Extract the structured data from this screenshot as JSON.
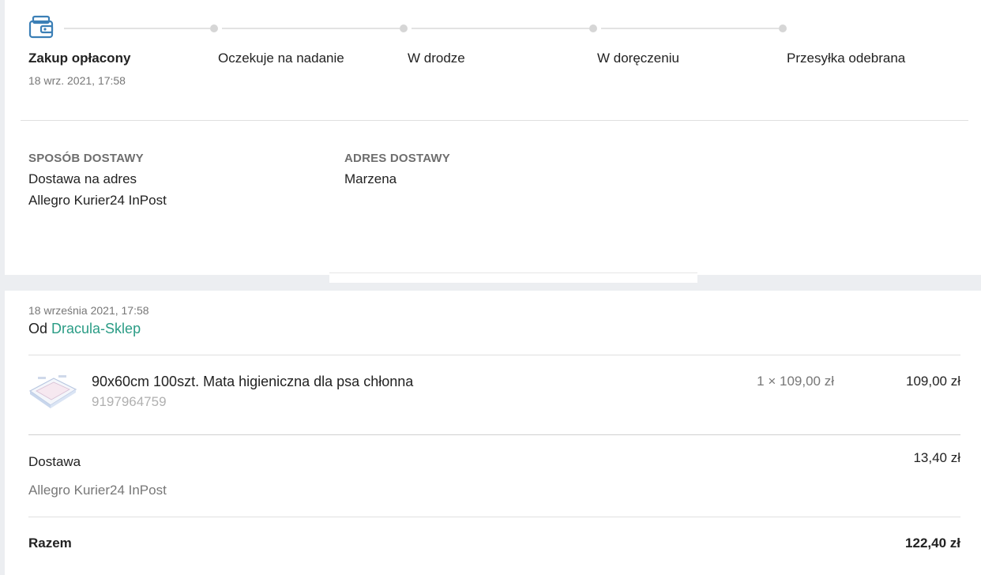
{
  "tracker": {
    "steps": [
      {
        "label": "Zakup opłacony",
        "active": true
      },
      {
        "label": "Oczekuje na nadanie",
        "active": false
      },
      {
        "label": "W drodze",
        "active": false
      },
      {
        "label": "W doręczeniu",
        "active": false
      },
      {
        "label": "Przesyłka odebrana",
        "active": false
      }
    ],
    "active_date": "18 wrz. 2021, 17:58",
    "icon": "wallet-icon",
    "accent_color": "#3b7fb6"
  },
  "delivery": {
    "method_heading": "SPOSÓB DOSTAWY",
    "method_line1": "Dostawa na adres",
    "method_line2": "Allegro Kurier24 InPost",
    "address_heading": "ADRES DOSTAWY",
    "address_name": "Marzena"
  },
  "order": {
    "date": "18 września 2021, 17:58",
    "from_prefix": "Od",
    "seller": "Dracula-Sklep",
    "item": {
      "title": "90x60cm 100szt. Mata higieniczna dla psa chłonna",
      "offer_id": "9197964759",
      "qty_price": "1 × 109,00 zł",
      "total": "109,00 zł"
    },
    "shipping": {
      "label": "Dostawa",
      "method": "Allegro Kurier24 InPost",
      "price": "13,40 zł"
    },
    "sum": {
      "label": "Razem",
      "value": "122,40 zł"
    }
  }
}
